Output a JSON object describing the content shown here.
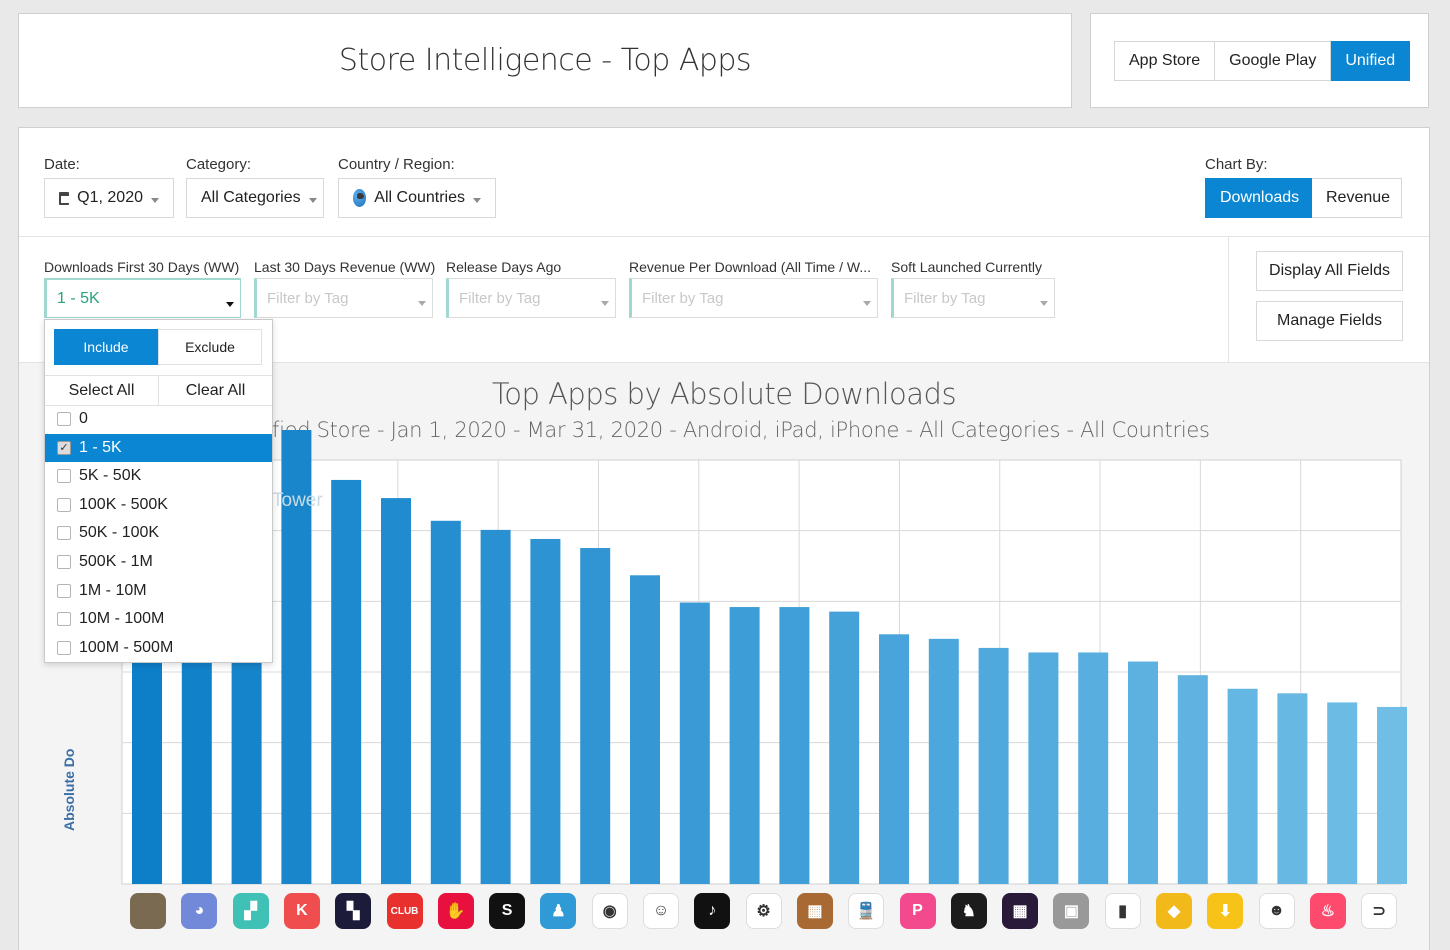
{
  "page_title": "Store Intelligence - Top Apps",
  "store_tabs": [
    "App Store",
    "Google Play",
    "Unified"
  ],
  "store_active": "Unified",
  "filters": {
    "date_label": "Date:",
    "date_value": "Q1, 2020",
    "category_label": "Category:",
    "category_value": "All Categories",
    "country_label": "Country / Region:",
    "country_value": "All Countries",
    "chart_by_label": "Chart By:",
    "chart_by_options": [
      "Downloads",
      "Revenue"
    ],
    "chart_by_active": "Downloads"
  },
  "fields": [
    {
      "label": "Downloads First 30 Days (WW)",
      "value": "1 - 5K"
    },
    {
      "label": "Last 30 Days Revenue (WW)",
      "placeholder": "Filter by Tag"
    },
    {
      "label": "Release Days Ago",
      "placeholder": "Filter by Tag"
    },
    {
      "label": "Revenue Per Download (All Time / W...",
      "placeholder": "Filter by Tag"
    },
    {
      "label": "Soft Launched Currently",
      "placeholder": "Filter by Tag"
    }
  ],
  "display_all_fields": "Display All Fields",
  "manage_fields": "Manage Fields",
  "dropdown": {
    "include": "Include",
    "exclude": "Exclude",
    "mode_active": "Include",
    "select_all": "Select All",
    "clear_all": "Clear All",
    "options": [
      "0",
      "1 - 5K",
      "5K - 50K",
      "100K - 500K",
      "50K - 100K",
      "500K - 1M",
      "1M - 10M",
      "10M - 100M",
      "100M - 500M"
    ],
    "selected": "1 - 5K",
    "check_mark": "✓"
  },
  "chart_title": "Top Apps by Absolute Downloads",
  "chart_subtitle": "Unified Store - Jan 1, 2020 - Mar 31, 2020 - Android, iPad, iPhone - All Categories - All Countries",
  "ylabel_visible": "Absolute Do",
  "ghost_label": "Tower",
  "chart_data": {
    "type": "bar",
    "ylabel": "Absolute Do",
    "values": [
      100,
      100,
      100,
      100,
      89,
      85,
      80,
      78,
      76,
      74,
      68,
      62,
      61,
      61,
      60,
      55,
      54,
      52,
      51,
      51,
      49,
      46,
      43,
      42,
      40,
      39
    ],
    "series_colors": [
      "#0d7fc9",
      "#70bde6"
    ]
  },
  "app_icons": [
    {
      "name": "strategy-game-icon",
      "bg": "#7a6a52",
      "glyph": ""
    },
    {
      "name": "discord-icon",
      "bg": "#7289da",
      "glyph": "◕"
    },
    {
      "name": "tower-game-icon",
      "bg": "#3fc2b5",
      "glyph": "▞"
    },
    {
      "name": "kinemaster-icon",
      "bg": "#f04e4e",
      "glyph": "K"
    },
    {
      "name": "tetris-icon",
      "bg": "#1c1c3a",
      "glyph": "▚"
    },
    {
      "name": "club-factory-icon",
      "bg": "#e8302f",
      "glyph": "CLUB"
    },
    {
      "name": "hand-app-icon",
      "bg": "#e8103e",
      "glyph": "✋"
    },
    {
      "name": "s-app-icon",
      "bg": "#111111",
      "glyph": "S"
    },
    {
      "name": "walk-app-icon",
      "bg": "#2f9ad6",
      "glyph": "♟"
    },
    {
      "name": "camera-app-icon",
      "bg": "#ffffff",
      "glyph": "◉"
    },
    {
      "name": "character-game-icon",
      "bg": "#ffffff",
      "glyph": "☺"
    },
    {
      "name": "tiktok-icon",
      "bg": "#111111",
      "glyph": "♪"
    },
    {
      "name": "settings-app-icon",
      "bg": "#ffffff",
      "glyph": "⚙"
    },
    {
      "name": "number-puzzle-icon",
      "bg": "#a86a32",
      "glyph": "▦"
    },
    {
      "name": "train-app-icon",
      "bg": "#ffffff",
      "glyph": "🚆"
    },
    {
      "name": "p-app-icon",
      "bg": "#f24a8c",
      "glyph": "P"
    },
    {
      "name": "chess-app-icon",
      "bg": "#1c1c1c",
      "glyph": "♞"
    },
    {
      "name": "grid-app-icon",
      "bg": "#2a1a3a",
      "glyph": "▦"
    },
    {
      "name": "social-folder-icon",
      "bg": "#999999",
      "glyph": "▣"
    },
    {
      "name": "khatabook-icon",
      "bg": "#ffffff",
      "glyph": "▮"
    },
    {
      "name": "diamond-app-icon",
      "bg": "#f2b91a",
      "glyph": "◆"
    },
    {
      "name": "download-app-icon",
      "bg": "#f7c318",
      "glyph": "⬇"
    },
    {
      "name": "blue-character-icon",
      "bg": "#ffffff",
      "glyph": "☻"
    },
    {
      "name": "tinder-icon",
      "bg": "#fe4a6c",
      "glyph": "♨"
    },
    {
      "name": "doordash-icon",
      "bg": "#ffffff",
      "glyph": "⊃"
    }
  ]
}
